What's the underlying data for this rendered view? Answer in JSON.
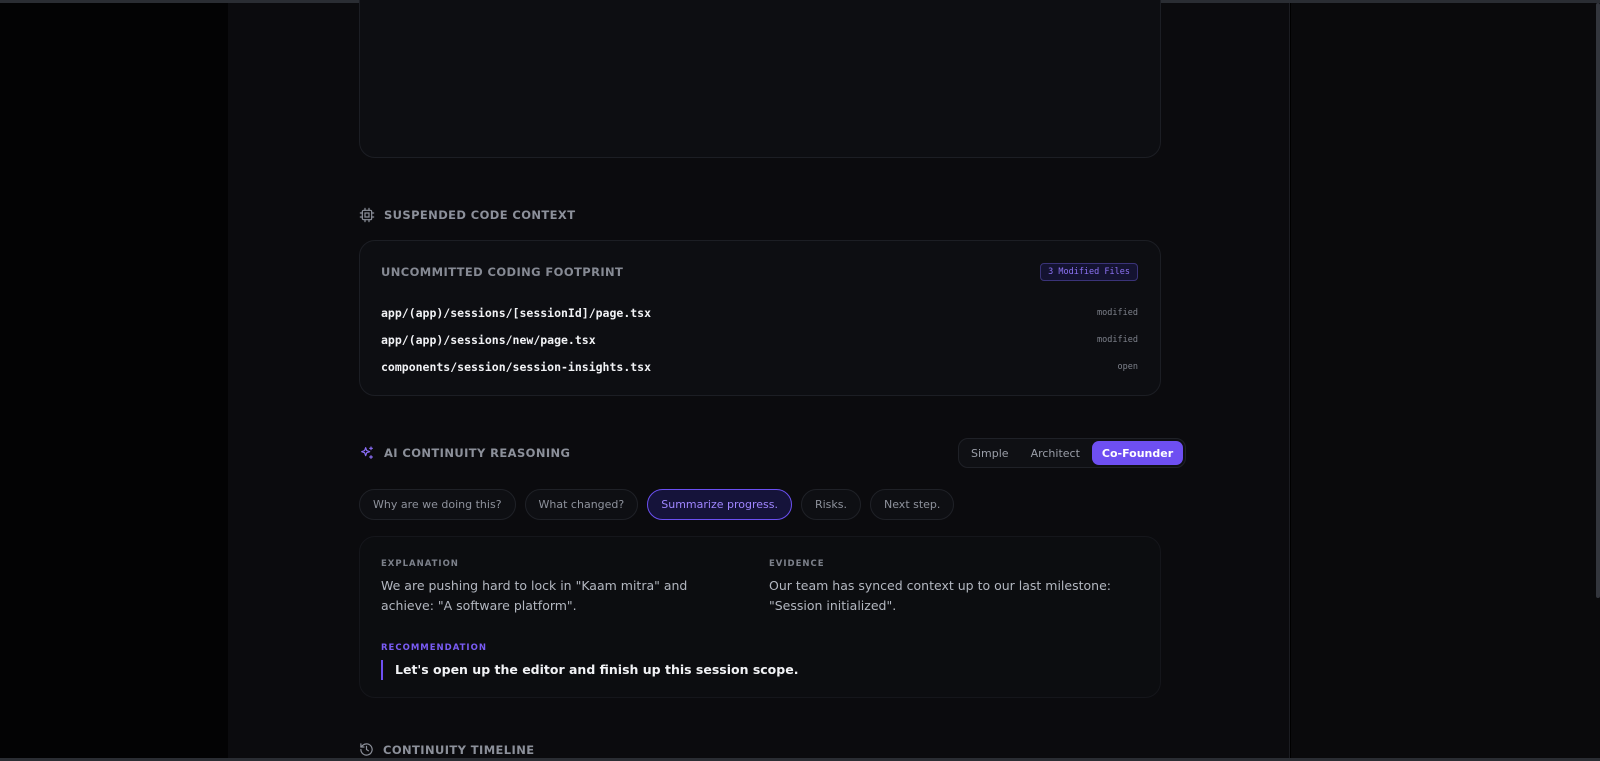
{
  "code_context": {
    "section_title": "SUSPENDED CODE CONTEXT",
    "card_title": "UNCOMMITTED CODING FOOTPRINT",
    "badge": "3 Modified Files",
    "files": [
      {
        "path": "app/(app)/sessions/[sessionId]/page.tsx",
        "status": "modified"
      },
      {
        "path": "app/(app)/sessions/new/page.tsx",
        "status": "modified"
      },
      {
        "path": "components/session/session-insights.tsx",
        "status": "open"
      }
    ]
  },
  "reasoning": {
    "section_title": "AI CONTINUITY REASONING",
    "modes": [
      {
        "label": "Simple",
        "active": false
      },
      {
        "label": "Architect",
        "active": false
      },
      {
        "label": "Co-Founder",
        "active": true
      }
    ],
    "questions": [
      {
        "label": "Why are we doing this?",
        "active": false
      },
      {
        "label": "What changed?",
        "active": false
      },
      {
        "label": "Summarize progress.",
        "active": true
      },
      {
        "label": "Risks.",
        "active": false
      },
      {
        "label": "Next step.",
        "active": false
      }
    ],
    "explanation_label": "EXPLANATION",
    "explanation_text": "We are pushing hard to lock in \"Kaam mitra\" and achieve: \"A software platform\".",
    "evidence_label": "EVIDENCE",
    "evidence_text": "Our team has synced context up to our last milestone: \"Session initialized\".",
    "recommendation_label": "RECOMMENDATION",
    "recommendation_text": "Let's open up the editor and finish up this session scope."
  },
  "timeline": {
    "section_title": "CONTINUITY TIMELINE"
  },
  "icons": {
    "code_context": "cpu-chip-icon",
    "reasoning": "sparkles-icon",
    "timeline": "history-icon"
  },
  "colors": {
    "accent": "#6e4ff2",
    "background": "#0b0b0e"
  }
}
